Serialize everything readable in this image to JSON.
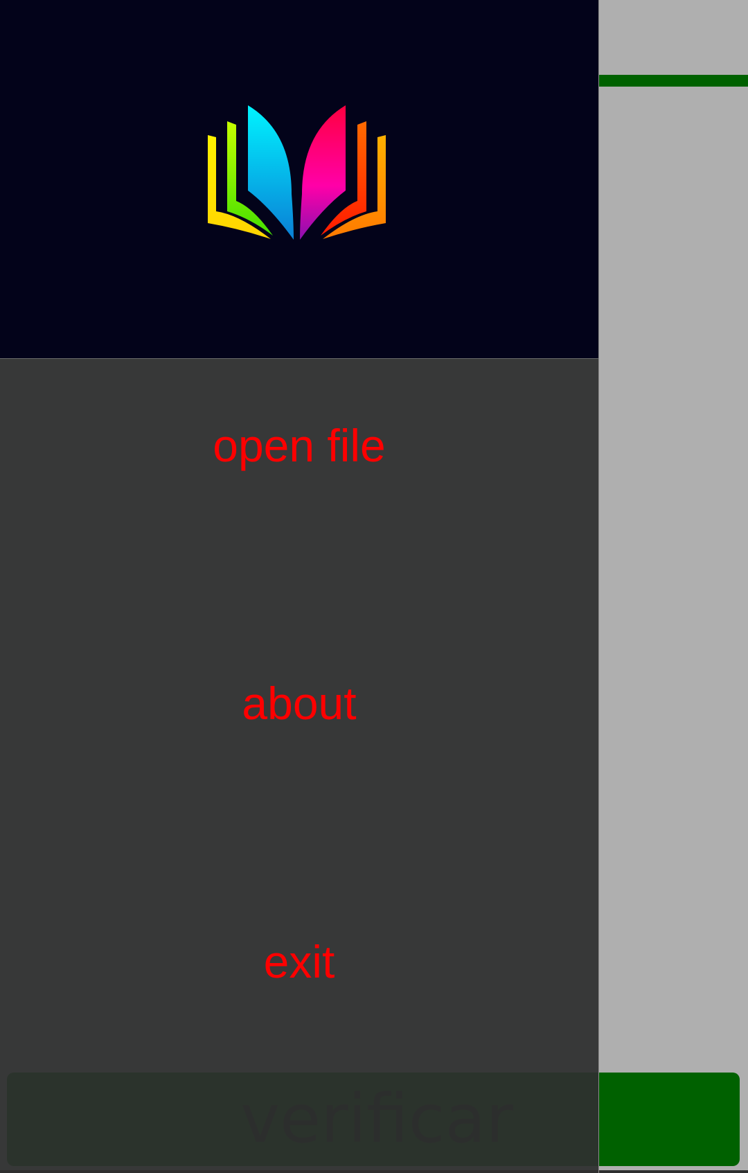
{
  "drawer": {
    "items": [
      {
        "label": "open file"
      },
      {
        "label": "about"
      },
      {
        "label": "exit"
      }
    ],
    "header_logo_icon": "open-book-icon"
  },
  "main": {
    "verify_button_label": "verificar"
  },
  "colors": {
    "menu_text": "#ff0000",
    "accent_green": "#006100",
    "drawer_background": "#2e2f2f",
    "header_background": "#03031a",
    "app_background": "#afafaf"
  }
}
